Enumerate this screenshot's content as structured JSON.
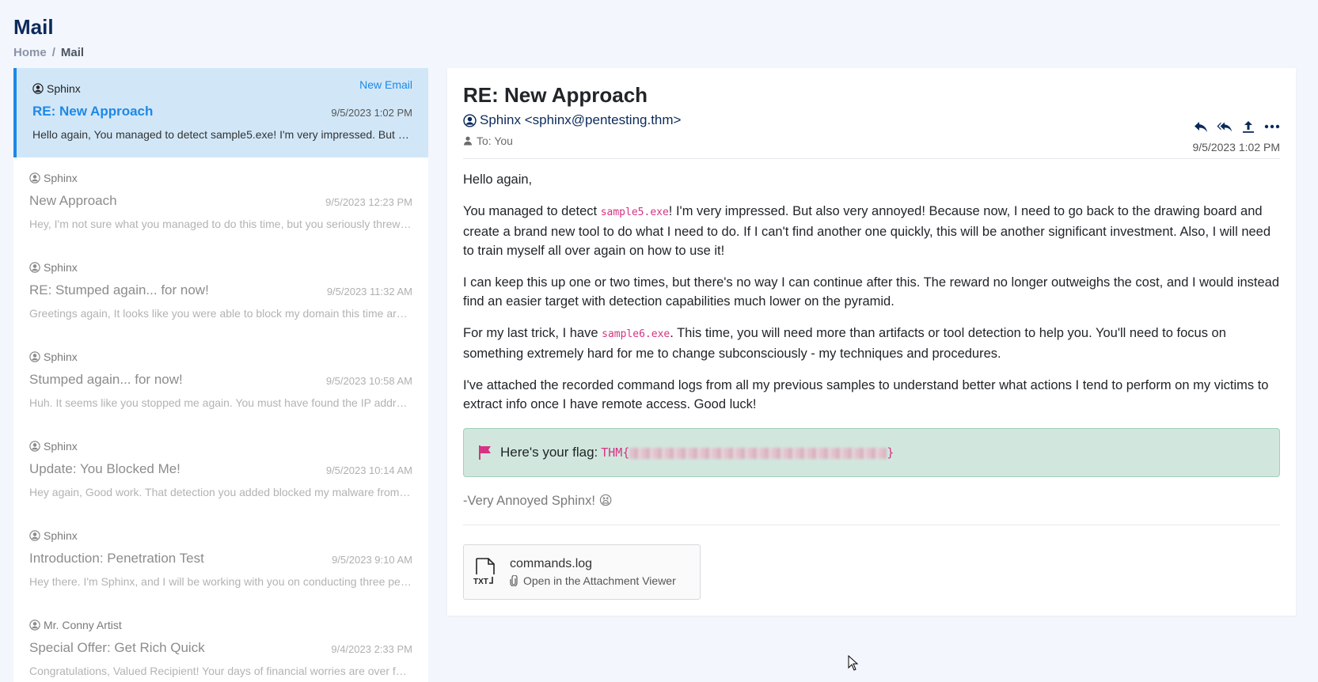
{
  "page": {
    "title": "Mail"
  },
  "breadcrumb": {
    "home": "Home",
    "separator": "/",
    "current": "Mail"
  },
  "mail_list": {
    "new_email_label": "New Email",
    "items": [
      {
        "sender": "Sphinx",
        "subject": "RE: New Approach",
        "date": "9/5/2023 1:02 PM",
        "preview": "Hello again, You managed to detect sample5.exe! I'm very impressed. But also very annoyed! Because now, I need to go back to the drawing board",
        "active": true
      },
      {
        "sender": "Sphinx",
        "subject": "New Approach",
        "date": "9/5/2023 12:23 PM",
        "preview": "Hey, I'm not sure what you managed to do this time, but you seriously threw a wrench in my plans."
      },
      {
        "sender": "Sphinx",
        "subject": "RE: Stumped again... for now!",
        "date": "9/5/2023 11:32 AM",
        "preview": "Greetings again, It looks like you were able to block my domain this time around."
      },
      {
        "sender": "Sphinx",
        "subject": "Stumped again... for now!",
        "date": "9/5/2023 10:58 AM",
        "preview": "Huh. It seems like you stopped me again. You must have found the IP address I was using."
      },
      {
        "sender": "Sphinx",
        "subject": "Update: You Blocked Me!",
        "date": "9/5/2023 10:14 AM",
        "preview": "Hey again, Good work. That detection you added blocked my malware from running."
      },
      {
        "sender": "Sphinx",
        "subject": "Introduction: Penetration Test",
        "date": "9/5/2023 9:10 AM",
        "preview": "Hey there. I'm Sphinx, and I will be working with you on conducting three penetration tests."
      },
      {
        "sender": "Mr. Conny Artist",
        "subject": "Special Offer: Get Rich Quick",
        "date": "9/4/2023 2:33 PM",
        "preview": "Congratulations, Valued Recipient! Your days of financial worries are over forever!"
      }
    ]
  },
  "email": {
    "subject": "RE: New Approach",
    "from": "Sphinx <sphinx@pentesting.thm>",
    "to": "To: You",
    "date": "9/5/2023 1:02 PM",
    "greeting": "Hello again,",
    "p1_before": "You managed to detect ",
    "p1_code": "sample5.exe",
    "p1_after": "! I'm very impressed. But also very annoyed! Because now, I need to go back to the drawing board and create a brand new tool to do what I need to do. If I can't find another one quickly, this will be another significant investment. Also, I will need to train myself all over again on how to use it!",
    "p2": "I can keep this up one or two times, but there's no way I can continue after this. The reward no longer outweighs the cost, and I would instead find an easier target with detection capabilities much lower on the pyramid.",
    "p3_before": "For my last trick, I have ",
    "p3_code": "sample6.exe",
    "p3_after": ". This time, you will need more than artifacts or tool detection to help you. You'll need to focus on something extremely hard for me to change subconsciously - my techniques and procedures.",
    "p4": "I've attached the recorded command logs from all my previous samples to understand better what actions I tend to perform on my victims to extract info once I have remote access. Good luck!",
    "flag_label": "Here's your flag:",
    "flag_prefix": "THM{",
    "flag_suffix": "}",
    "signoff": "-Very Annoyed Sphinx! 😫",
    "attachment": {
      "name": "commands.log",
      "link_text": "Open in the Attachment Viewer",
      "type_label": "TXT"
    }
  },
  "colors": {
    "accent": "#1e88e5",
    "title": "#0b2a5b",
    "flag_bg": "#d1e7dd",
    "code": "#d63384",
    "flag_icon": "#d63384"
  }
}
